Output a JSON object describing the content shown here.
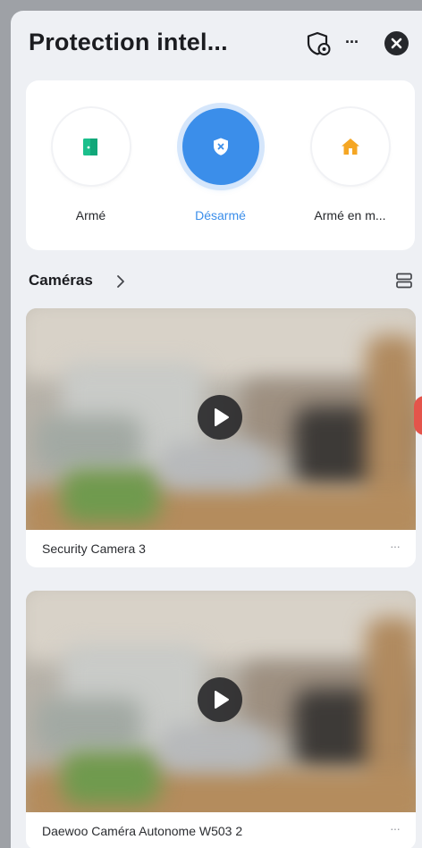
{
  "header": {
    "title": "Protection intel...",
    "more_label": "···"
  },
  "modes": [
    {
      "label": "Armé",
      "icon": "door-icon",
      "active": false,
      "icon_color": "#1bbf8c"
    },
    {
      "label": "Désarmé",
      "icon": "shield-x-icon",
      "active": true,
      "icon_color": "#ffffff"
    },
    {
      "label": "Armé en m...",
      "icon": "home-icon",
      "active": false,
      "icon_color": "#f5a623"
    }
  ],
  "cameras": {
    "section_title": "Caméras",
    "items": [
      {
        "name": "Security Camera 3",
        "more": "···"
      },
      {
        "name": "Daewoo Caméra Autonome W503 2",
        "more": "···"
      }
    ]
  },
  "colors": {
    "accent": "#3b8eea",
    "background": "#eef0f4"
  }
}
